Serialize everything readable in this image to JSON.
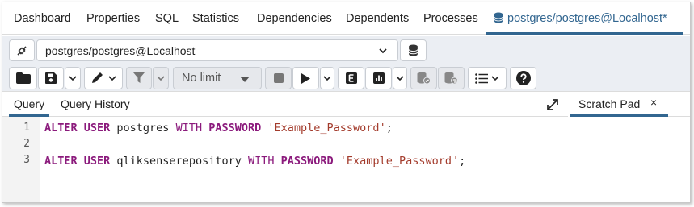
{
  "top_tabs": [
    {
      "label": "Dashboard"
    },
    {
      "label": "Properties"
    },
    {
      "label": "SQL"
    },
    {
      "label": "Statistics"
    },
    {
      "label": "Dependencies"
    },
    {
      "label": "Dependents"
    },
    {
      "label": "Processes"
    },
    {
      "label": "postgres/postgres@Localhost*",
      "active": true
    }
  ],
  "connection": {
    "selected": "postgres/postgres@Localhost"
  },
  "toolbar": {
    "limit": "No limit"
  },
  "editor_tabs": [
    {
      "label": "Query",
      "active": true
    },
    {
      "label": "Query History"
    }
  ],
  "scratch_pad": {
    "title": "Scratch Pad",
    "close": "×"
  },
  "editor": {
    "line_numbers": [
      "1",
      "2",
      "3"
    ],
    "lines": [
      {
        "kw1": "ALTER USER",
        "ident": " postgres ",
        "kw2": "WITH",
        "kw3": "PASSWORD",
        "str": "'Example_Password",
        "str_end": "'",
        "end": ";"
      },
      {},
      {
        "kw1": "ALTER USER",
        "ident": " qliksenserepository ",
        "kw2": "WITH",
        "kw3": "PASSWORD",
        "str": "'Example_Password",
        "str_end": "'",
        "end": ";"
      }
    ]
  },
  "colors": {
    "accent": "#326690",
    "keyword": "#8b1a7c",
    "string": "#a33b2c",
    "toolbar_bg": "#ebeef3"
  }
}
